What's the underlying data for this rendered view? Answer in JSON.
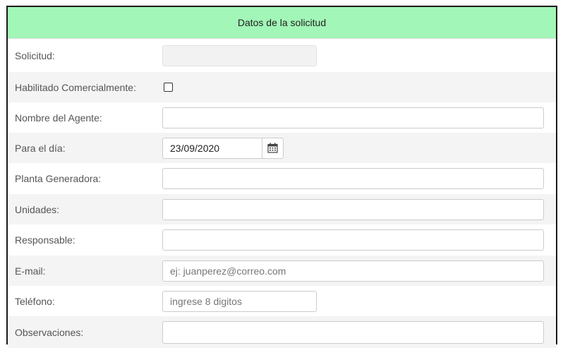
{
  "form": {
    "title": "Datos de la solicitud",
    "fields": {
      "solicitud": {
        "label": "Solicitud:",
        "value": ""
      },
      "habilitado": {
        "label": "Habilitado Comercialmente:",
        "checked": false
      },
      "nombre_agente": {
        "label": "Nombre del Agente:",
        "value": ""
      },
      "para_el_dia": {
        "label": "Para el día:",
        "value": "23/09/2020",
        "icon": "calendar-icon"
      },
      "planta": {
        "label": "Planta Generadora:",
        "value": ""
      },
      "unidades": {
        "label": "Unidades:",
        "value": ""
      },
      "responsable": {
        "label": "Responsable:",
        "value": ""
      },
      "email": {
        "label": "E-mail:",
        "value": "",
        "placeholder": "ej: juanperez@correo.com"
      },
      "telefono": {
        "label": "Teléfono:",
        "value": "",
        "placeholder": "ingrese 8 digitos"
      },
      "observaciones": {
        "label": "Observaciones:",
        "value": ""
      }
    }
  },
  "colors": {
    "header_bg": "#a2f6b7",
    "row_shade": "#f4f4f4"
  }
}
